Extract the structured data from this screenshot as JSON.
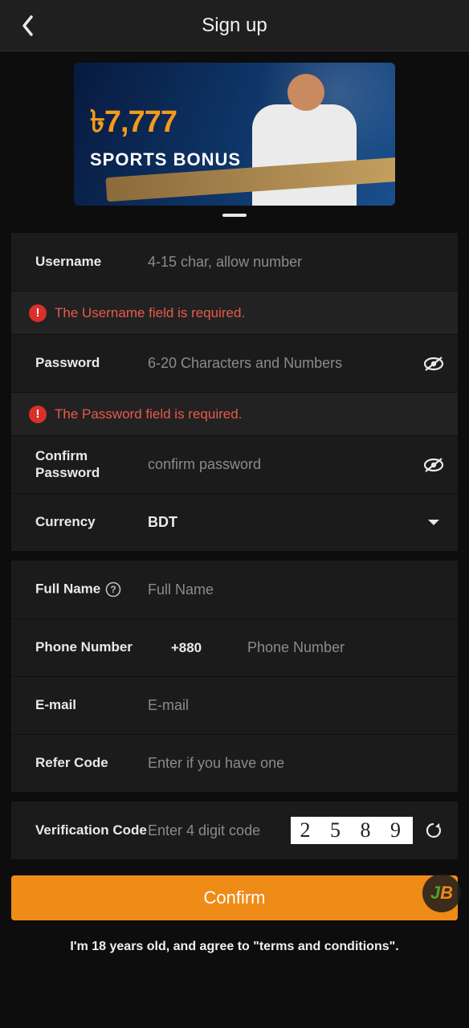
{
  "header": {
    "title": "Sign up"
  },
  "banner": {
    "bonus": "৳7,777",
    "sub": "SPORTS BONUS"
  },
  "fields": {
    "username": {
      "label": "Username",
      "placeholder": "4-15 char, allow number"
    },
    "usernameError": "The Username field is required.",
    "password": {
      "label": "Password",
      "placeholder": "6-20 Characters and Numbers"
    },
    "passwordError": "The Password field is required.",
    "confirm": {
      "label": "Confirm Password",
      "placeholder": "confirm password"
    },
    "currency": {
      "label": "Currency",
      "value": "BDT"
    },
    "fullname": {
      "label": "Full Name",
      "placeholder": "Full Name"
    },
    "phone": {
      "label": "Phone Number",
      "code": "+880",
      "placeholder": "Phone Number"
    },
    "email": {
      "label": "E-mail",
      "placeholder": "E-mail"
    },
    "refer": {
      "label": "Refer Code",
      "placeholder": "Enter if you have one"
    },
    "verify": {
      "label": "Verification Code",
      "placeholder": "Enter 4 digit code",
      "captcha": "2 5 8 9"
    }
  },
  "confirmButton": "Confirm",
  "agreement": "I'm 18 years old, and agree to \"terms and conditions\"."
}
